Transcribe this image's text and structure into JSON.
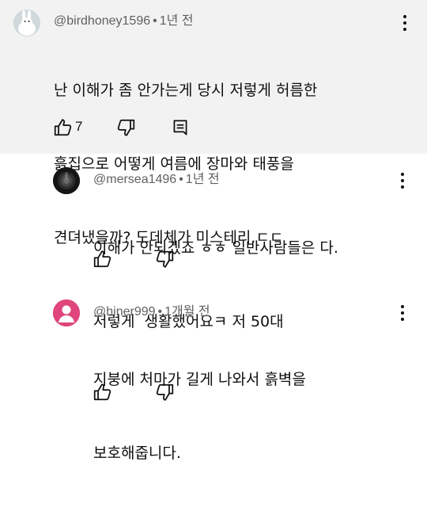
{
  "comments": [
    {
      "author": "@birdhoney1596",
      "separator": "•",
      "time": "1년 전",
      "lines": [
        "난 이해가 좀 안가는게 당시 저렇게 허름한",
        "흙집으로 어떻게 여름에 장마와 태풍을",
        "견뎌냈을까? 도데체가 미스테리.ㄷㄷ"
      ],
      "likes": "7",
      "avatar_icon": "white-rabbit-avatar",
      "highlighted": true
    },
    {
      "author": "@mersea1496",
      "separator": "•",
      "time": "1년 전",
      "lines": [
        "이해가 안되겠죠 ㅎㅎ 일반사람들은 다.",
        "저렇게  생활했어요ㅋ 저 50대"
      ],
      "avatar_icon": "dark-rose-avatar"
    },
    {
      "author": "@hiner999",
      "separator": "•",
      "time": "1개월 전",
      "lines": [
        "지붕에 처마가 길게 나와서 흙벽을",
        "보호해줍니다."
      ],
      "avatar_icon": "default-person-avatar",
      "avatar_color": "#e0457b"
    }
  ],
  "colors": {
    "highlight_bg": "#f2f2f2",
    "meta_text": "#606060",
    "text": "#0f0f0f"
  }
}
